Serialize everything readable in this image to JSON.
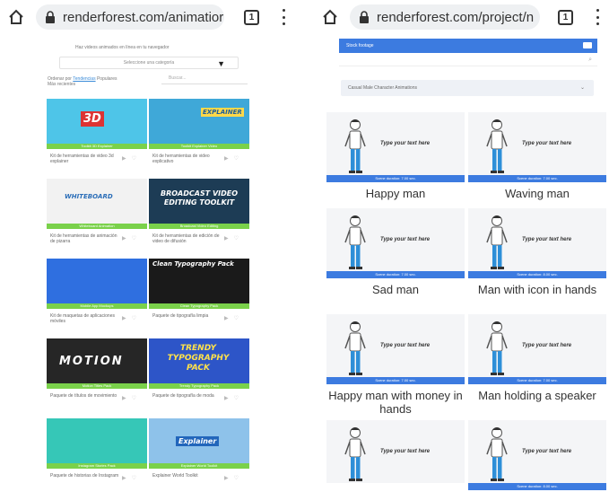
{
  "left": {
    "url": "renderforest.com/animatior",
    "tab_count": "1",
    "tagline": "Haz videos animados en línea en tu navegador",
    "category_placeholder": "Seleccione una categoría",
    "sort": {
      "label": "Ordenar por",
      "active": "Tendencias",
      "other": "Populares",
      "sub": "Más recientes"
    },
    "search_placeholder": "Buscar...",
    "cards": [
      {
        "title": "Kit de herramientas de video 3d explainer",
        "badge": "Toolkit 3D Explainer",
        "thumb_text": "3D",
        "thumb_color": "#4ec5e8"
      },
      {
        "title": "Kit de herramientas de video explicativo",
        "badge": "Toolkit Explainer Video",
        "thumb_text": "EXPLAINER",
        "thumb_color": "#3fa8d8"
      },
      {
        "title": "Kit de herramientas de animación de pizarra",
        "badge": "Whiteboard Animation",
        "thumb_text": "WHITEBOARD",
        "thumb_color": "#f2f2f2"
      },
      {
        "title": "Kit de herramientas de edición de video de difusión",
        "badge": "Broadcast Video Editing",
        "thumb_text": "BROADCAST VIDEO EDITING TOOLKIT",
        "thumb_color": "#1d3c55"
      },
      {
        "title": "Kit de maquetas de aplicaciones móviles",
        "badge": "Mobile App Mockups",
        "thumb_text": "",
        "thumb_color": "#2f6fe0"
      },
      {
        "title": "Paquete de tipografía limpia",
        "badge": "Clean Typography Pack",
        "thumb_text": "Clean Typography Pack",
        "thumb_color": "#1a1a1a"
      },
      {
        "title": "Paquete de títulos de movimiento",
        "badge": "Motion Titles Pack",
        "thumb_text": "MOTION",
        "thumb_color": "#262626"
      },
      {
        "title": "Paquete de tipografía de moda",
        "badge": "Trendy Typography Pack",
        "thumb_text": "TRENDY TYPOGRAPHY PACK",
        "thumb_color": "#2d55c8"
      },
      {
        "title": "Paquete de historias de Instagram",
        "badge": "Instagram Stories Pack",
        "thumb_text": "",
        "thumb_color": "#36c7b7"
      },
      {
        "title": "Explainer World Toolkit",
        "badge": "Explainer World Toolkit",
        "thumb_text": "Explainer",
        "thumb_color": "#8ec2ea"
      }
    ]
  },
  "right": {
    "url": "renderforest.com/project/n",
    "tab_count": "1",
    "stock_label": "Stock footage",
    "category": "Casual Male Character Animations",
    "placeholder_text": "Type your text here",
    "scenes": [
      {
        "name": "Happy man",
        "duration": "Scene duration: 7.00 sec."
      },
      {
        "name": "Waving man",
        "duration": "Scene duration: 7.00 sec."
      },
      {
        "name": "Sad man",
        "duration": "Scene duration: 7.00 sec."
      },
      {
        "name": "Man with icon in hands",
        "duration": "Scene duration: 8.00 sec."
      },
      {
        "name": "Happy man with money in hands",
        "duration": "Scene duration: 7.00 sec."
      },
      {
        "name": "Man holding a speaker",
        "duration": "Scene duration: 7.00 sec."
      },
      {
        "name": "",
        "duration": ""
      },
      {
        "name": "",
        "duration": "Scene duration: 8.00 sec."
      }
    ]
  },
  "colors": {
    "green_bar": "#7ad14a",
    "blue_accent": "#3c7be0",
    "url_bg": "#eef0f2"
  }
}
